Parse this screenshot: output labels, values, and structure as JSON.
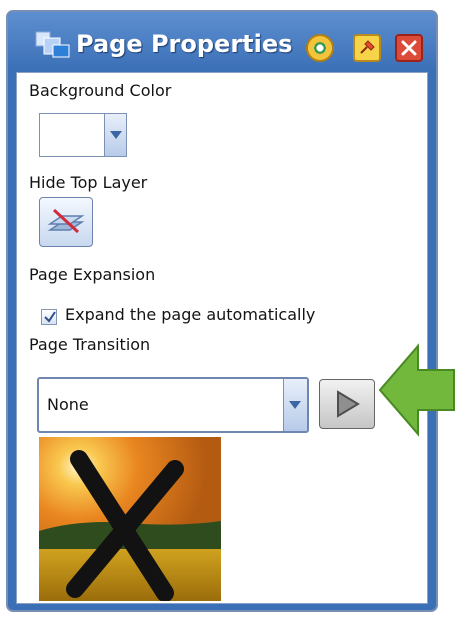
{
  "window": {
    "title": "Page Properties",
    "icons": [
      "page-properties-icon",
      "eye-icon",
      "pin-icon",
      "close-icon"
    ]
  },
  "background_color": {
    "label": "Background Color",
    "selected_color": "#ffffff"
  },
  "hide_top_layer": {
    "label": "Hide Top Layer",
    "button_icon": "hide-layer-icon"
  },
  "page_expansion": {
    "label": "Page Expansion",
    "checkbox_label": "Expand the page automatically",
    "checked": true
  },
  "page_transition": {
    "label": "Page Transition",
    "selected": "None",
    "play_icon": "play-icon"
  },
  "preview": {
    "icon": "cross-mark-icon"
  },
  "annotation": {
    "arrow_icon": "left-pointing-arrow-icon",
    "arrow_color": "#72b83d"
  },
  "colors": {
    "frame": "#3b6fb6",
    "text": "#141414",
    "accent_border": "#7c91b3"
  }
}
